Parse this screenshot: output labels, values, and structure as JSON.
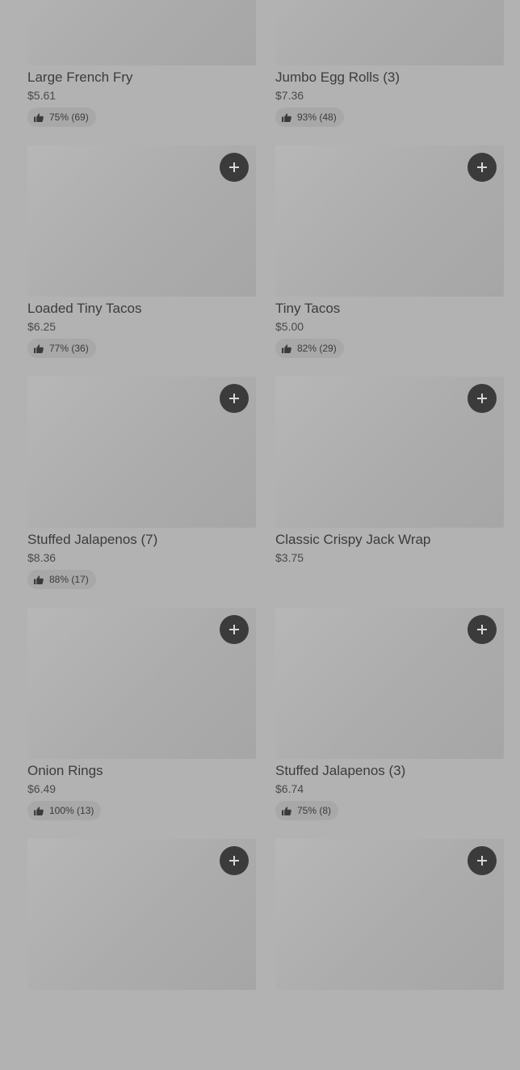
{
  "colors": {
    "page_background": "#b2b2b2",
    "add_button": "#3b3b3b",
    "rating_pill": "#a8a8a8"
  },
  "icons": {
    "add": "plus-icon",
    "rating": "thumbs-up-icon"
  },
  "items": [
    {
      "name": "Large French Fry",
      "price": "$5.61",
      "rating": "75% (69)"
    },
    {
      "name": "Jumbo Egg Rolls (3)",
      "price": "$7.36",
      "rating": "93% (48)"
    },
    {
      "name": "Loaded Tiny Tacos",
      "price": "$6.25",
      "rating": "77% (36)"
    },
    {
      "name": "Tiny Tacos",
      "price": "$5.00",
      "rating": "82% (29)"
    },
    {
      "name": "Stuffed Jalapenos (7)",
      "price": "$8.36",
      "rating": "88% (17)"
    },
    {
      "name": "Classic Crispy Jack Wrap",
      "price": "$3.75",
      "rating": null
    },
    {
      "name": "Onion Rings",
      "price": "$6.49",
      "rating": "100% (13)"
    },
    {
      "name": "Stuffed Jalapenos (3)",
      "price": "$6.74",
      "rating": "75% (8)"
    },
    {
      "name": "",
      "price": "",
      "rating": null
    },
    {
      "name": "",
      "price": "",
      "rating": null
    }
  ]
}
